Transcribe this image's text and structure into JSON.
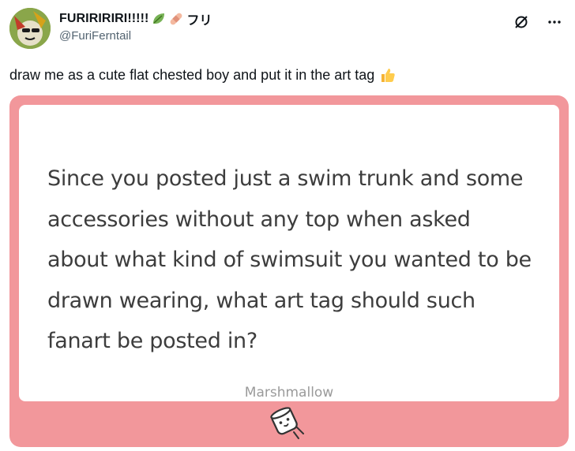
{
  "user": {
    "display_name": "FURIRIRIRI!!!!!",
    "name_suffix": "フリ",
    "handle": "@FuriFerntail"
  },
  "icons": {
    "grok": "slashed-circle-icon",
    "more": "more-dots-icon",
    "thumbs": "thumbs-up-icon",
    "leaf": "leaf-icon",
    "bandage": "bandage-icon",
    "marshmallow": "marshmallow-icon"
  },
  "tweet": {
    "text": "draw me as a cute flat chested boy and put it in the art tag"
  },
  "card": {
    "question_lines": [
      "Since you posted just a swim trunk and some",
      "accessories without any top when asked",
      "about what kind of swimsuit you wanted to be",
      "drawn wearing, what art tag should such",
      "fanart be posted in?"
    ],
    "brand": "Marshmallow"
  },
  "colors": {
    "card_bg": "#f2979b",
    "text_primary": "#0f1419",
    "text_secondary": "#536471"
  }
}
